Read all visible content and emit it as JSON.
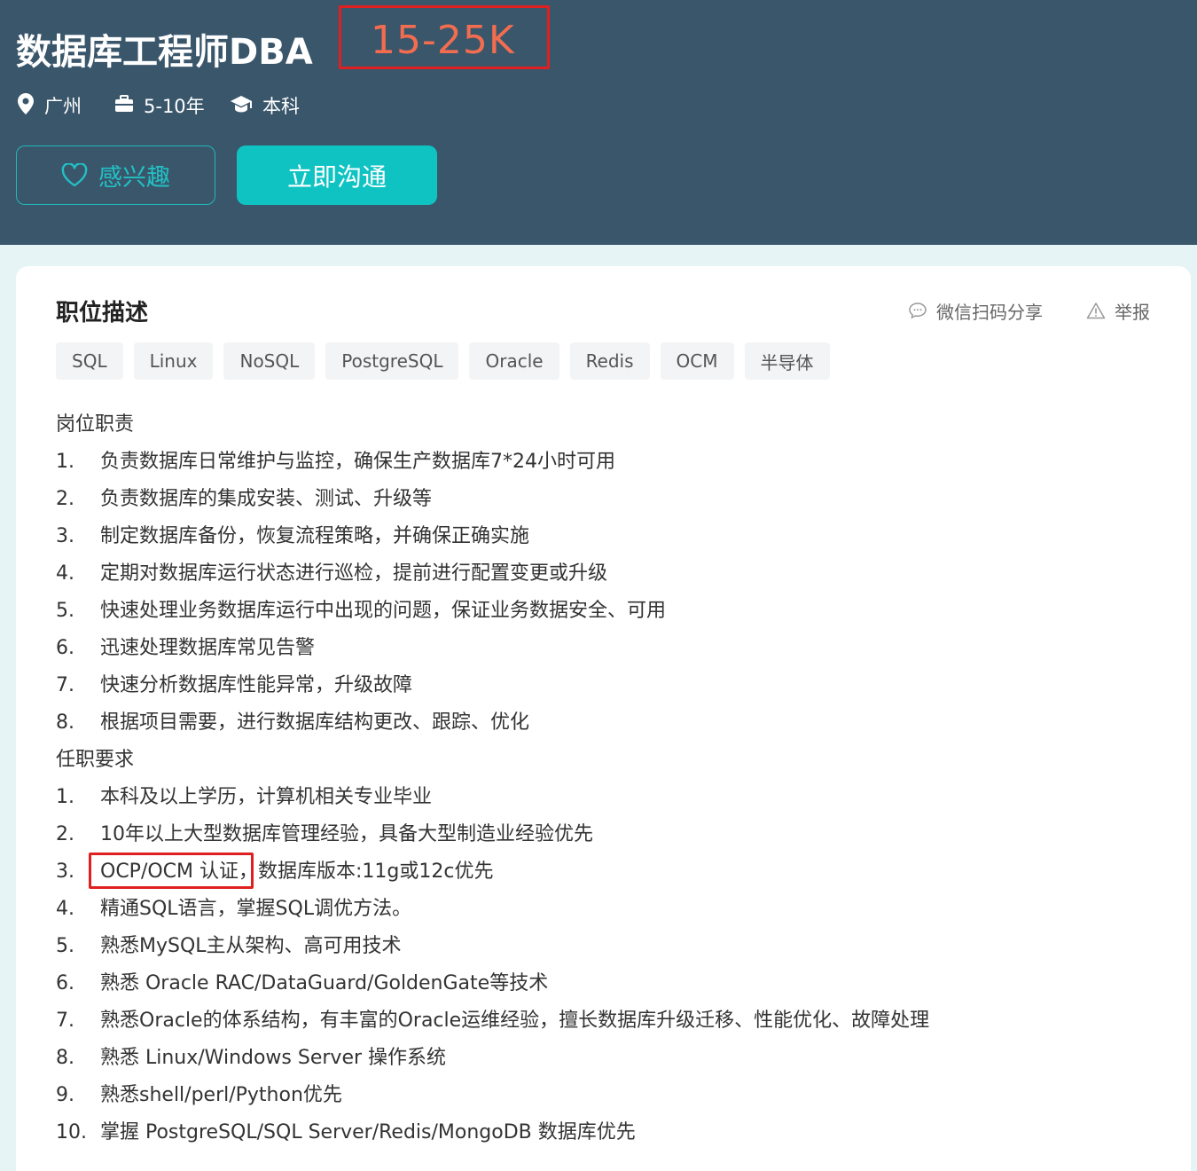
{
  "header": {
    "title": "数据库工程师DBA",
    "salary": "15-25K",
    "city": "广州",
    "experience": "5-10年",
    "degree": "本科",
    "interest_label": "感兴趣",
    "chat_label": "立即沟通"
  },
  "section": {
    "title": "职位描述",
    "share_label": "微信扫码分享",
    "report_label": "举报"
  },
  "tags": [
    "SQL",
    "Linux",
    "NoSQL",
    "PostgreSQL",
    "Oracle",
    "Redis",
    "OCM",
    "半导体"
  ],
  "description": {
    "duties_heading": "岗位职责",
    "duties": [
      {
        "n": "1.",
        "t": "负责数据库日常维护与监控，确保生产数据库7*24小时可用"
      },
      {
        "n": "2.",
        "t": "负责数据库的集成安装、测试、升级等"
      },
      {
        "n": "3.",
        "t": "制定数据库备份，恢复流程策略，并确保正确实施"
      },
      {
        "n": "4.",
        "t": "定期对数据库运行状态进行巡检，提前进行配置变更或升级"
      },
      {
        "n": "5.",
        "t": "快速处理业务数据库运行中出现的问题，保证业务数据安全、可用"
      },
      {
        "n": "6.",
        "t": "迅速处理数据库常见告警"
      },
      {
        "n": "7.",
        "t": "快速分析数据库性能异常，升级故障"
      },
      {
        "n": "8.",
        "t": "根据项目需要，进行数据库结构更改、跟踪、优化"
      }
    ],
    "requirements_heading": "任职要求",
    "requirements": [
      {
        "n": "1.",
        "t": "本科及以上学历，计算机相关专业毕业"
      },
      {
        "n": "2.",
        "t": "10年以上大型数据库管理经验，具备大型制造业经验优先"
      },
      {
        "n": "3.",
        "t": "OCP/OCM 认证，数据库版本:11g或12c优先"
      },
      {
        "n": "4.",
        "t": "精通SQL语言，掌握SQL调优方法。"
      },
      {
        "n": "5.",
        "t": "熟悉MySQL主从架构、高可用技术"
      },
      {
        "n": "6.",
        "t": "熟悉 Oracle RAC/DataGuard/GoldenGate等技术"
      },
      {
        "n": "7.",
        "t": "熟悉Oracle的体系结构，有丰富的Oracle运维经验，擅长数据库升级迁移、性能优化、故障处理"
      },
      {
        "n": "8.",
        "t": "熟悉 Linux/Windows Server 操作系统"
      },
      {
        "n": "9.",
        "t": "熟悉shell/perl/Python优先"
      },
      {
        "n": "10.",
        "t": "掌握 PostgreSQL/SQL Server/Redis/MongoDB 数据库优先"
      }
    ]
  },
  "colors": {
    "header_bg": "#3a566b",
    "accent_teal": "#10c3c3",
    "salary": "#f26d50",
    "highlight_red": "#e02020"
  },
  "icons": {
    "city": "location-pin-icon",
    "experience": "briefcase-icon",
    "degree": "graduation-cap-icon",
    "interest": "heart-icon",
    "share": "chat-bubble-icon",
    "report": "warning-triangle-icon"
  }
}
